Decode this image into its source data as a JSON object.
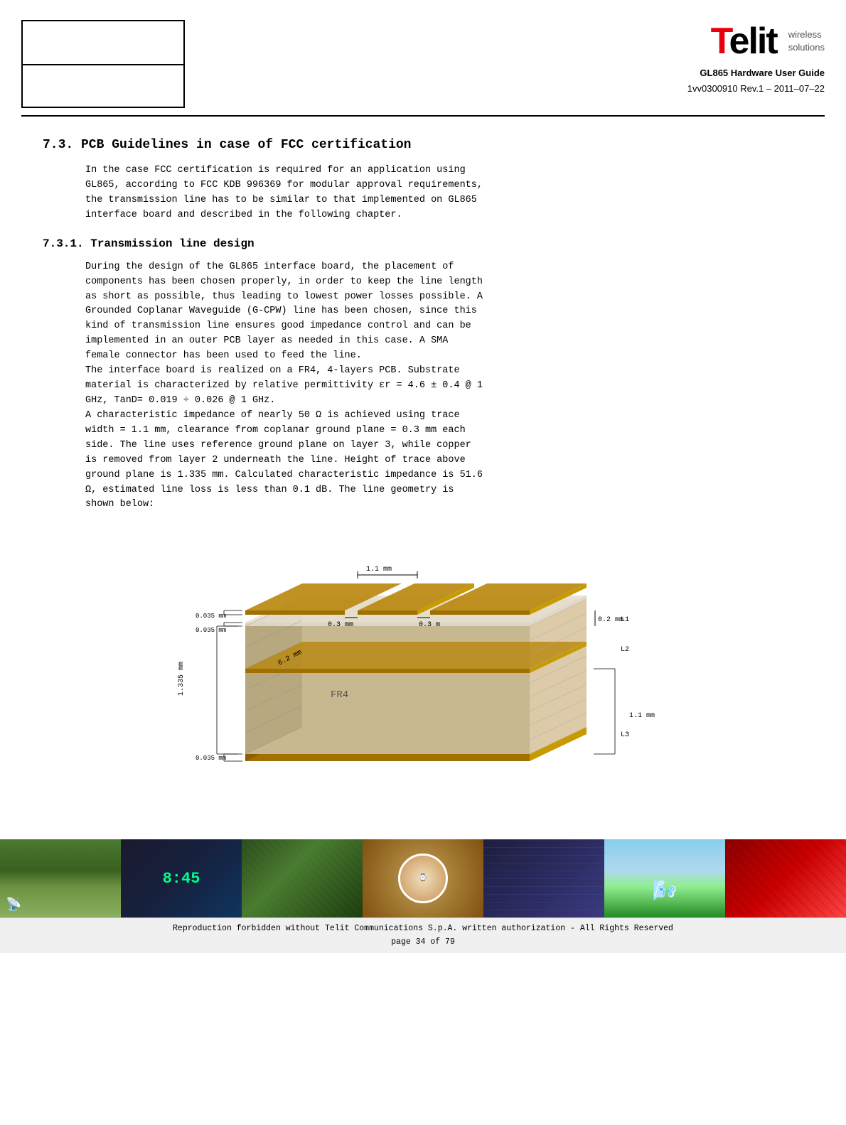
{
  "header": {
    "logo_telit": "Telit",
    "logo_wireless": "wireless\nsolutions",
    "doc_title": "GL865 Hardware User Guide",
    "doc_rev": "1vv0300910 Rev.1 – 2011–07–22"
  },
  "sections": {
    "section_7_3_heading": "7.3.    PCB Guidelines in case of FCC certification",
    "section_7_3_body": "In the case FCC certification is required for an application using\nGL865, according to FCC KDB 996369 for modular approval requirements,\nthe transmission line has to be similar to that implemented on GL865\ninterface board and described in the following chapter.",
    "section_7_3_1_heading": "7.3.1.   Transmission line design",
    "section_7_3_1_body1": "During the design of the GL865 interface board, the placement of\ncomponents has been chosen properly, in order to keep the line length\nas short as possible, thus leading to lowest power losses possible. A\nGrounded Coplanar Waveguide (G-CPW) line has been chosen, since this\nkind of transmission line ensures good impedance control and can be\nimplemented in an outer PCB layer as needed in this case. A SMA\nfemale connector has been used to feed the line.\nThe interface board is realized on a FR4, 4-layers PCB. Substrate\nmaterial is characterized by relative permittivity εr = 4.6 ± 0.4 @ 1\nGHz, TanD= 0.019 ÷ 0.026 @ 1 GHz.\nA characteristic impedance of nearly 50 Ω is achieved using trace\nwidth = 1.1 mm, clearance from coplanar ground plane = 0.3 mm each\nside. The line uses reference ground plane on layer 3, while copper\nis removed from layer 2 underneath the line. Height of trace above\nground plane is 1.335 mm. Calculated characteristic impedance is 51.6\nΩ, estimated line loss is less than 0.1 dB. The line geometry is\nshown below:"
  },
  "diagram": {
    "label_1_1mm_top": "1.1 mm",
    "label_0_3mm": "0.3 mm",
    "label_0_3mm_right": "0.3 m",
    "label_6_2mm": "6.2 mm",
    "label_0_2mm": "0.2 mm",
    "label_0_035mm_1": "0.035 mm",
    "label_0_035mm_2": "0.035 mm",
    "label_0_035mm_3": "0.035 mm",
    "label_1_335mm": "1.335 mm",
    "label_1_1mm_right": "1.1 mm",
    "label_L1": "L1",
    "label_L2": "L2",
    "label_L3": "L3",
    "label_FR4": "FR4"
  },
  "footer": {
    "line1": "Reproduction forbidden without Telit Communications S.p.A. written authorization - All Rights Reserved",
    "line2": "page 34 of 79"
  }
}
